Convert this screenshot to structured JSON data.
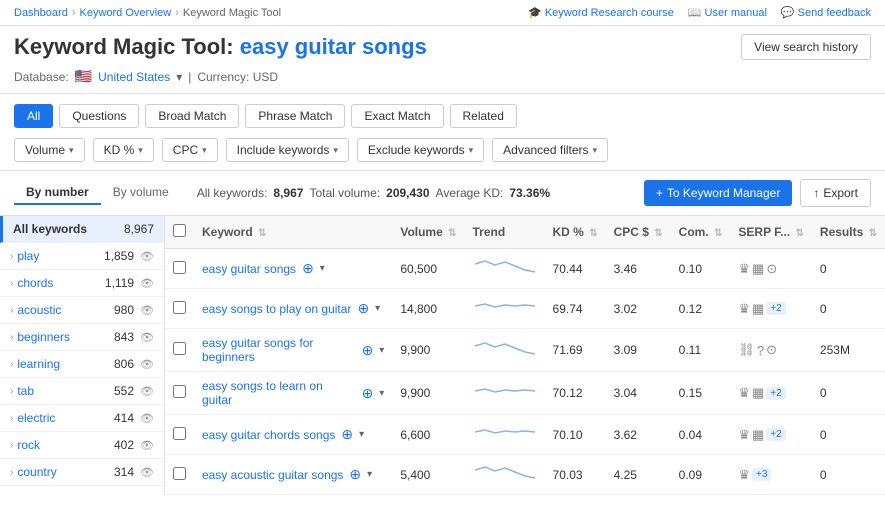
{
  "breadcrumb": {
    "items": [
      "Dashboard",
      "Keyword Overview",
      "Keyword Magic Tool"
    ]
  },
  "top_links": [
    {
      "icon": "graduation-cap-icon",
      "label": "Keyword Research course"
    },
    {
      "icon": "book-icon",
      "label": "User manual"
    },
    {
      "icon": "chat-icon",
      "label": "Send feedback"
    }
  ],
  "header": {
    "title_prefix": "Keyword Magic Tool:",
    "title_query": "easy guitar songs",
    "view_history": "View search history"
  },
  "db_row": {
    "label": "Database:",
    "country": "United States",
    "currency_label": "Currency: USD"
  },
  "filter_tabs": [
    {
      "label": "All",
      "active": true
    },
    {
      "label": "Questions",
      "active": false
    },
    {
      "label": "Broad Match",
      "active": false
    },
    {
      "label": "Phrase Match",
      "active": false
    },
    {
      "label": "Exact Match",
      "active": false
    },
    {
      "label": "Related",
      "active": false
    }
  ],
  "filter_dropdowns": [
    {
      "label": "Volume"
    },
    {
      "label": "KD %"
    },
    {
      "label": "CPC"
    },
    {
      "label": "Include keywords"
    },
    {
      "label": "Exclude keywords"
    },
    {
      "label": "Advanced filters"
    }
  ],
  "by_tabs": [
    {
      "label": "By number",
      "active": true
    },
    {
      "label": "By volume",
      "active": false
    }
  ],
  "stats": {
    "all_keywords_label": "All keywords:",
    "all_keywords_value": "8,967",
    "total_volume_label": "Total volume:",
    "total_volume_value": "209,430",
    "avg_kd_label": "Average KD:",
    "avg_kd_value": "73.36%"
  },
  "action_buttons": {
    "keyword_manager": "+ To Keyword Manager",
    "export": "Export"
  },
  "sidebar": {
    "header_label": "All keywords",
    "header_count": "8,967",
    "items": [
      {
        "label": "play",
        "count": "1,859"
      },
      {
        "label": "chords",
        "count": "1,119"
      },
      {
        "label": "acoustic",
        "count": "980"
      },
      {
        "label": "beginners",
        "count": "843"
      },
      {
        "label": "learning",
        "count": "806"
      },
      {
        "label": "tab",
        "count": "552"
      },
      {
        "label": "electric",
        "count": "414"
      },
      {
        "label": "rock",
        "count": "402"
      },
      {
        "label": "country",
        "count": "314"
      }
    ]
  },
  "table": {
    "columns": [
      {
        "label": "",
        "key": "checkbox"
      },
      {
        "label": "Keyword",
        "key": "keyword"
      },
      {
        "label": "Volume",
        "key": "volume"
      },
      {
        "label": "Trend",
        "key": "trend"
      },
      {
        "label": "KD %",
        "key": "kd"
      },
      {
        "label": "CPC $",
        "key": "cpc"
      },
      {
        "label": "Com.",
        "key": "com"
      },
      {
        "label": "SERP F...",
        "key": "serp"
      },
      {
        "label": "Results",
        "key": "results"
      }
    ],
    "rows": [
      {
        "keyword": "easy guitar songs",
        "volume": "60,500",
        "trend": "down",
        "kd": "70.44",
        "cpc": "3.46",
        "com": "0.10",
        "serp_icons": [
          "crown",
          "table",
          "clock"
        ],
        "results": "0"
      },
      {
        "keyword": "easy songs to play on guitar",
        "volume": "14,800",
        "trend": "flat",
        "kd": "69.74",
        "cpc": "3.02",
        "com": "0.12",
        "serp_icons": [
          "crown",
          "table"
        ],
        "serp_badge": "+2",
        "results": "0"
      },
      {
        "keyword": "easy guitar songs for beginners",
        "volume": "9,900",
        "trend": "down",
        "kd": "71.69",
        "cpc": "3.09",
        "com": "0.11",
        "serp_icons": [
          "link",
          "question",
          "clock"
        ],
        "results": "253M"
      },
      {
        "keyword": "easy songs to learn on guitar",
        "volume": "9,900",
        "trend": "flat",
        "kd": "70.12",
        "cpc": "3.04",
        "com": "0.15",
        "serp_icons": [
          "crown",
          "table"
        ],
        "serp_badge": "+2",
        "results": "0"
      },
      {
        "keyword": "easy guitar chords songs",
        "volume": "6,600",
        "trend": "flat",
        "kd": "70.10",
        "cpc": "3.62",
        "com": "0.04",
        "serp_icons": [
          "crown",
          "table"
        ],
        "serp_badge": "+2",
        "results": "0"
      },
      {
        "keyword": "easy acoustic guitar songs",
        "volume": "5,400",
        "trend": "down",
        "kd": "70.03",
        "cpc": "4.25",
        "com": "0.09",
        "serp_icons": [
          "crown"
        ],
        "serp_badge": "+3",
        "results": "0"
      }
    ]
  }
}
